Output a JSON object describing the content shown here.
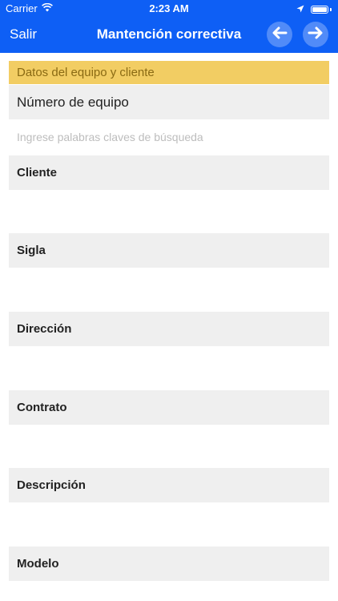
{
  "status_bar": {
    "carrier": "Carrier",
    "time": "2:23 AM",
    "icons": [
      "wifi-icon",
      "location-icon",
      "battery-icon"
    ]
  },
  "nav": {
    "back_label": "Salir",
    "title": "Mantención correctiva",
    "prev_icon": "arrow-left-icon",
    "next_icon": "arrow-right-icon",
    "accent_color": "#0e5ff5"
  },
  "form": {
    "section_header": "Datos del equipo y cliente",
    "section_color": "#f2cd63",
    "equipment_label": "Número de equipo",
    "search_placeholder": "Ingrese palabras claves de búsqueda",
    "search_value": "",
    "fields": [
      {
        "label": "Cliente"
      },
      {
        "label": "Sigla"
      },
      {
        "label": "Dirección"
      },
      {
        "label": "Contrato"
      },
      {
        "label": "Descripción"
      },
      {
        "label": "Modelo"
      }
    ]
  }
}
